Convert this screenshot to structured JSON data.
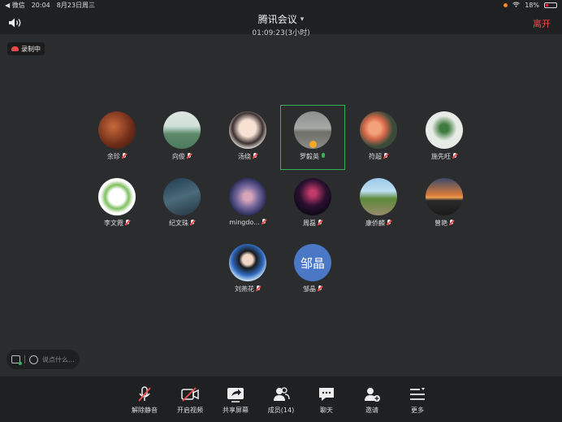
{
  "status_bar": {
    "app_back": "◀ 微信",
    "time": "20:04",
    "date": "8月23日周三",
    "battery": "18%"
  },
  "header": {
    "title": "腾讯会议",
    "timer": "01:09:23(3小时)",
    "leave": "离开"
  },
  "recording_badge": "录制中",
  "participants": [
    {
      "name": "余珍",
      "mic": "muted"
    },
    {
      "name": "向俊",
      "mic": "muted"
    },
    {
      "name": "汤绕",
      "mic": "muted"
    },
    {
      "name": "罗毅英",
      "mic": "on",
      "active": true
    },
    {
      "name": "符超",
      "mic": "muted"
    },
    {
      "name": "施先旺",
      "mic": "muted"
    },
    {
      "name": "李文霞",
      "mic": "muted"
    },
    {
      "name": "纪文珠",
      "mic": "muted"
    },
    {
      "name": "mingdo...",
      "mic": "muted"
    },
    {
      "name": "周磊",
      "mic": "muted"
    },
    {
      "name": "康侨麟",
      "mic": "muted"
    },
    {
      "name": "曾艳",
      "mic": "muted"
    },
    {
      "name": "刘燕花",
      "mic": "muted"
    },
    {
      "name": "邹晶",
      "mic": "muted",
      "avatar_text": "邹晶"
    }
  ],
  "chat_input": {
    "placeholder": "说点什么..."
  },
  "toolbar": {
    "unmute": "解除静音",
    "video": "开启视频",
    "share": "共享屏幕",
    "members": "成员(14)",
    "chat": "聊天",
    "invite": "邀请",
    "more": "更多"
  },
  "colors": {
    "background": "#2b2c2e",
    "bar": "#1f2022",
    "leave": "#f04b4b",
    "active_border": "#34b35a",
    "mic_muted": "#f04b4b"
  }
}
